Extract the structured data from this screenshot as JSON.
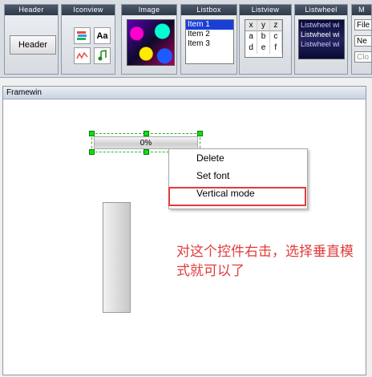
{
  "palette": {
    "tiles": [
      "Header",
      "Iconview",
      "Image",
      "Listbox",
      "Listview",
      "Listwheel",
      "M"
    ],
    "header_button": "Header",
    "iconview_icons": [
      "stack-icon",
      "font-icon",
      "chart-icon",
      "music-icon"
    ],
    "iconview_font_glyph": "Aa",
    "listbox_items": [
      "Item 1",
      "Item 2",
      "Item 3"
    ],
    "listview": {
      "headers": [
        "x",
        "y",
        "z"
      ],
      "rows": [
        [
          "a",
          "b",
          "c"
        ],
        [
          "d",
          "e",
          "f"
        ]
      ]
    },
    "listwheel_items": [
      "Listwheel wi",
      "Listwheel wi",
      "Listwheel wi"
    ],
    "dropdown_items": [
      "File",
      "Ne",
      "Clo"
    ]
  },
  "framewin": {
    "title": "Framewin",
    "progress_text": "0%",
    "progress_value": 0
  },
  "context_menu": {
    "items": [
      "Delete",
      "Set font",
      "Vertical mode"
    ],
    "highlighted": "Vertical mode"
  },
  "annotation": {
    "text": "对这个控件右击，选择垂直模式就可以了",
    "color": "#e23b3b"
  },
  "colors": {
    "handle": "#11dd11",
    "selection": "#1a3fd6",
    "annotation": "#e23b3b"
  }
}
